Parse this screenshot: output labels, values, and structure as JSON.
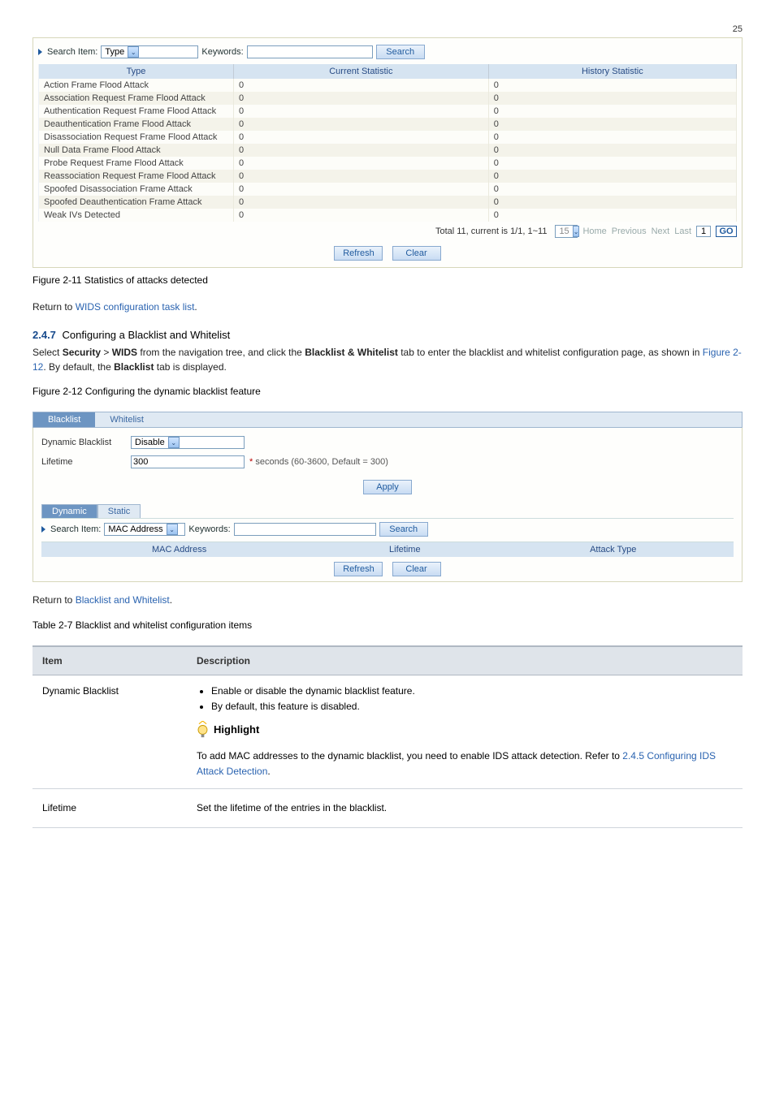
{
  "pagenum": "25",
  "fig1": {
    "search_label": "Search Item:",
    "search_item": "Type",
    "keywords_label": "Keywords:",
    "search_btn": "Search",
    "headers": [
      "Type",
      "Current Statistic",
      "History Statistic"
    ],
    "rows": [
      {
        "t": "Action Frame Flood Attack",
        "c": "0",
        "h": "0"
      },
      {
        "t": "Association Request Frame Flood Attack",
        "c": "0",
        "h": "0"
      },
      {
        "t": "Authentication Request Frame Flood Attack",
        "c": "0",
        "h": "0"
      },
      {
        "t": "Deauthentication Frame Flood Attack",
        "c": "0",
        "h": "0"
      },
      {
        "t": "Disassociation Request Frame Flood Attack",
        "c": "0",
        "h": "0"
      },
      {
        "t": "Null Data Frame Flood Attack",
        "c": "0",
        "h": "0"
      },
      {
        "t": "Probe Request Frame Flood Attack",
        "c": "0",
        "h": "0"
      },
      {
        "t": "Reassociation Request Frame Flood Attack",
        "c": "0",
        "h": "0"
      },
      {
        "t": "Spoofed Disassociation Frame Attack",
        "c": "0",
        "h": "0"
      },
      {
        "t": "Spoofed Deauthentication Frame Attack",
        "c": "0",
        "h": "0"
      },
      {
        "t": "Weak IVs Detected",
        "c": "0",
        "h": "0"
      }
    ],
    "pager_sum": "Total 11, current is 1/1, 1~11",
    "pager_per": "15",
    "pager_links": {
      "home": "Home",
      "prev": "Previous",
      "next": "Next",
      "last": "Last"
    },
    "pager_page": "1",
    "go": "GO",
    "refresh": "Refresh",
    "clear": "Clear",
    "caption": "Figure 2-11 Statistics of attacks detected"
  },
  "body": {
    "ret1": "Return to ",
    "ret1_link": "WIDS configuration task list",
    "sec_num": "2.4.7",
    "sec_title": "Configuring a Blacklist and Whitelist",
    "intro": "Select ",
    "crumb1": "Security",
    "crumb2": "WIDS",
    "intro2": " from the navigation tree, and click the ",
    "bw": "Blacklist & Whitelist",
    "intro3": " tab to enter the blacklist and whitelist configuration page, as shown in ",
    "figref": "Figure 2-12",
    "intro_tail": ". By default, the ",
    "bl": "Blacklist",
    "tab_word": " tab is displayed.",
    "fig2_caption": "Figure 2-12 Configuring the dynamic blacklist feature"
  },
  "fig2": {
    "tabs": {
      "active": "Blacklist",
      "inactive": "Whitelist"
    },
    "dbl_label": "Dynamic Blacklist",
    "dbl_value": "Disable",
    "lt_label": "Lifetime",
    "lt_value": "300",
    "lt_hint": "seconds (60-3600, Default = 300)",
    "apply": "Apply",
    "subtabs": {
      "dyn": "Dynamic",
      "stat": "Static"
    },
    "search_label": "Search Item:",
    "search_item": "MAC Address",
    "keywords_label": "Keywords:",
    "search_btn": "Search",
    "headers": [
      "MAC Address",
      "Lifetime",
      "Attack Type"
    ],
    "refresh": "Refresh",
    "clear": "Clear"
  },
  "body2": {
    "ret": "Return to ",
    "ret_link": "Blacklist and Whitelist",
    "table_title": "Table 2-7 Blacklist and whitelist configuration items",
    "th1": "Item",
    "th2": "Description",
    "r1c1": "Dynamic Blacklist",
    "r1b1": "Enable or disable the dynamic blacklist feature.",
    "r1b2": "By default, this feature is disabled.",
    "highlight": "Highlight",
    "r1after": "To add MAC addresses to the dynamic blacklist, you need to enable IDS attack detection. Refer to ",
    "r1link": "2.4.5 Configuring IDS Attack Detection",
    "r1tail": ".",
    "r2c1": "Lifetime",
    "r2c2": "Set the lifetime of the entries in the blacklist."
  }
}
